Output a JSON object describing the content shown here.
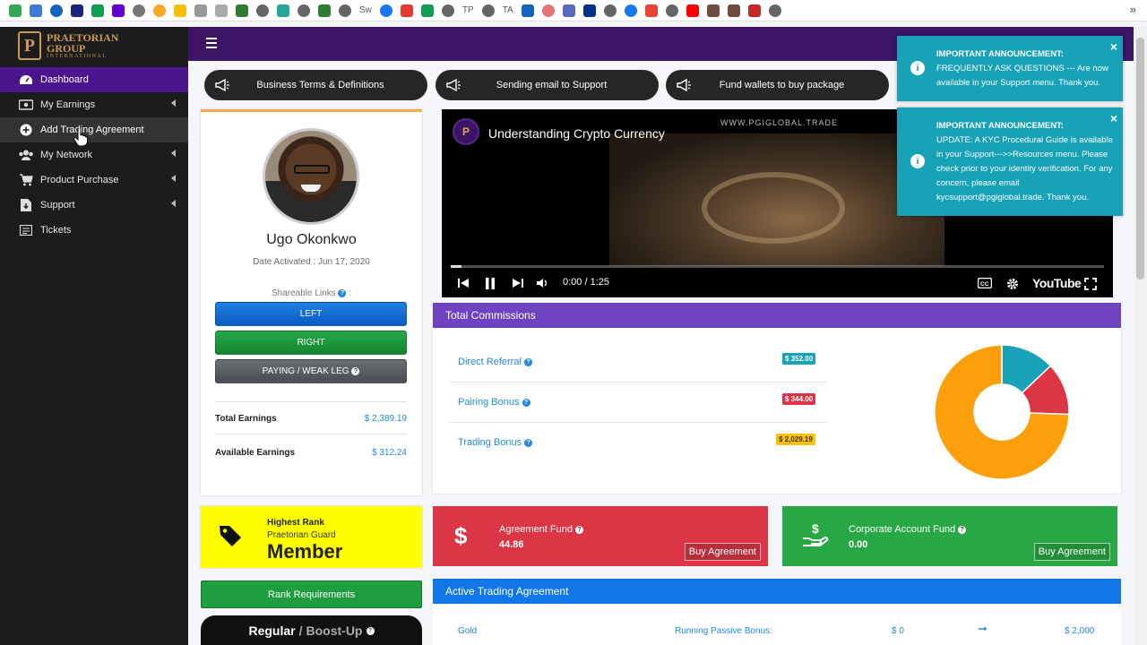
{
  "bookmarks": {
    "items": [
      {
        "icon": "google-drive-icon",
        "color": "#34a853"
      },
      {
        "icon": "cloud-icon",
        "color": "#3a7bd5"
      },
      {
        "icon": "gear-icon",
        "color": "#1565c0"
      },
      {
        "icon": "sdo-icon",
        "color": "#1a237e"
      },
      {
        "icon": "sheets-icon",
        "color": "#0f9d58"
      },
      {
        "icon": "yahoo-icon",
        "color": "#6001d2"
      },
      {
        "icon": "infinity-icon",
        "color": "#555555"
      },
      {
        "icon": "half-moon-icon",
        "color": "#f9a825"
      },
      {
        "icon": "drive-icon",
        "color": "#fbbc04"
      },
      {
        "icon": "layers-icon",
        "color": "#777777"
      },
      {
        "icon": "wave-icon",
        "color": "#777777"
      },
      {
        "icon": "columns-icon",
        "color": "#2e7d32"
      },
      {
        "icon": "globe-icon",
        "color": "#666666"
      },
      {
        "icon": "square-teal-icon",
        "color": "#26a69a"
      },
      {
        "icon": "globe-icon",
        "color": "#666666"
      },
      {
        "icon": "t-green-icon",
        "color": "#2e7d32"
      }
    ],
    "text_sw": "Sw",
    "text_tp": "TP",
    "text_ta": "TA",
    "more": "»"
  },
  "brand": {
    "initials": "P",
    "line1": "PRAETORIAN",
    "line2": "GROUP",
    "line3": "INTERNATIONAL"
  },
  "sidebar": {
    "items": [
      {
        "label": "Dashboard"
      },
      {
        "label": "My Earnings"
      },
      {
        "label": "Add Trading Agreement"
      },
      {
        "label": "My Network"
      },
      {
        "label": "Product Purchase"
      },
      {
        "label": "Support"
      },
      {
        "label": "Tickets"
      }
    ]
  },
  "pills": [
    {
      "label": "Business Terms & Definitions"
    },
    {
      "label": "Sending email to Support"
    },
    {
      "label": "Fund wallets to buy package"
    }
  ],
  "profile": {
    "name": "Ugo Okonkwo",
    "date_activated": "Date Activated : Jun 17, 2020",
    "shareable_label": "Shareable Links",
    "shareable_suffix": ":",
    "btn_left": "LEFT",
    "btn_right": "RIGHT",
    "btn_weak": "PAYING / WEAK LEG",
    "total_label": "Total Earnings",
    "total_value": "$ 2,389.19",
    "available_label": "Available Earnings",
    "available_value": "$ 312.24"
  },
  "video": {
    "title": "Understanding Crypto Currency",
    "url": "WWW.PGIGLOBAL.TRADE",
    "time": "0:00 / 1:25",
    "brand": "YouTube",
    "logo_letter": "P"
  },
  "commissions": {
    "title": "Total Commissions",
    "rows": [
      {
        "label": "Direct Referral",
        "badge": "$ 352.00",
        "color": "#17a2b8"
      },
      {
        "label": "Pairing Bonus",
        "badge": "$ 344.00",
        "color": "#dc3545"
      },
      {
        "label": "Trading Bonus",
        "badge": "$ 2,029.19",
        "color": "#ffc107"
      }
    ]
  },
  "chart_data": {
    "type": "pie",
    "categories": [
      "Direct Referral",
      "Pairing Bonus",
      "Trading Bonus"
    ],
    "values": [
      352.0,
      344.0,
      2029.19
    ],
    "colors": [
      "#17a2b8",
      "#dc3545",
      "#fd9f0a"
    ],
    "title": "",
    "donut": true
  },
  "rank": {
    "label": "Highest Rank",
    "sub": "Praetorian Guard",
    "value": "Member"
  },
  "funds": {
    "agreement_label": "Agreement Fund",
    "agreement_value": "44.86",
    "corporate_label": "Corporate Account Fund",
    "corporate_value": "0.00",
    "buy_label": "Buy Agreement"
  },
  "rank_requirements": "Rank Requirements",
  "regular_boost": {
    "a": "Regular",
    "sep": "/",
    "b": "Boost-Up"
  },
  "active_agreement": {
    "title": "Active Trading Agreement",
    "c1": "Gold",
    "c2": "Running Passive Bonus:",
    "c3": "$ 0",
    "c4": "➞",
    "c5": "$ 2,000"
  },
  "toasts": [
    {
      "title": "IMPORTANT ANNOUNCEMENT:",
      "body": "FREQUENTLY ASK QUESTIONS --- Are now available in your Support menu. Thank you.",
      "close": "×",
      "icon": "i"
    },
    {
      "title": "IMPORTANT ANNOUNCEMENT:",
      "body": "UPDATE: A KYC Procedural Guide is available in your Support--->>Resources menu. Please check prior to your identity verification. For any concern, please email kycsupport@pgiglobal.trade. Thank you.",
      "close": "×",
      "icon": "i"
    }
  ]
}
